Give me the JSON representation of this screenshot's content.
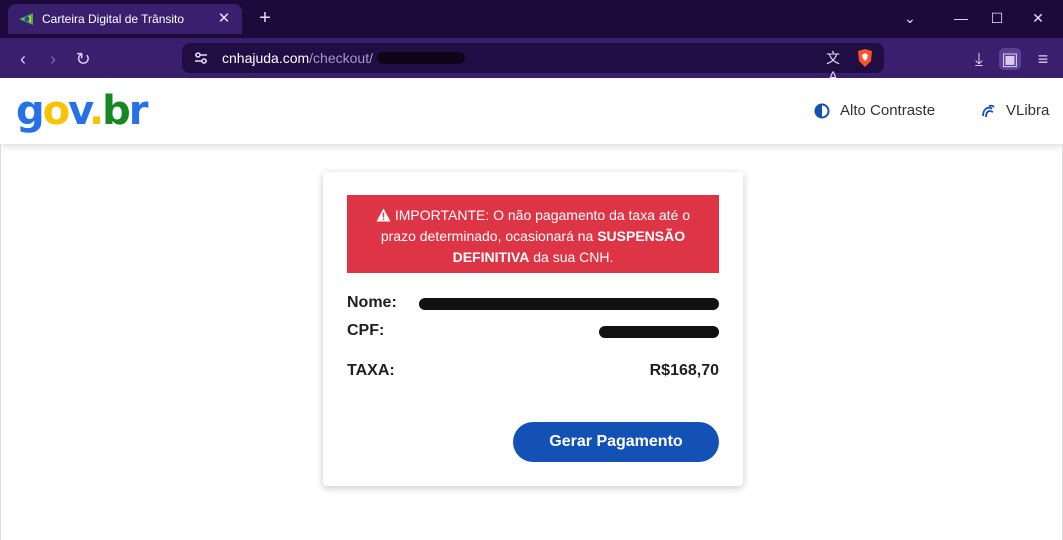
{
  "browser": {
    "tab_title": "Carteira Digital de Trânsito",
    "url_host": "cnhajuda.com",
    "url_path": "/checkout/"
  },
  "header": {
    "logo_text": "gov.br",
    "alto_contraste": "Alto Contraste",
    "vlibra": "VLibra"
  },
  "card": {
    "alert": {
      "prefix": "IMPORTANTE: O não pagamento da taxa até o prazo determinado, ocasionará na ",
      "emphasis": "SUSPENSÃO DEFINITIVA",
      "suffix": " da sua CNH."
    },
    "nome_label": "Nome:",
    "cpf_label": "CPF:",
    "taxa_label": "TAXA:",
    "taxa_value": "R$168,70",
    "pay_button": "Gerar Pagamento"
  },
  "colors": {
    "alert_bg": "#dd3545",
    "button_bg": "#1351b4",
    "browser_bg": "#3a1f6e"
  }
}
